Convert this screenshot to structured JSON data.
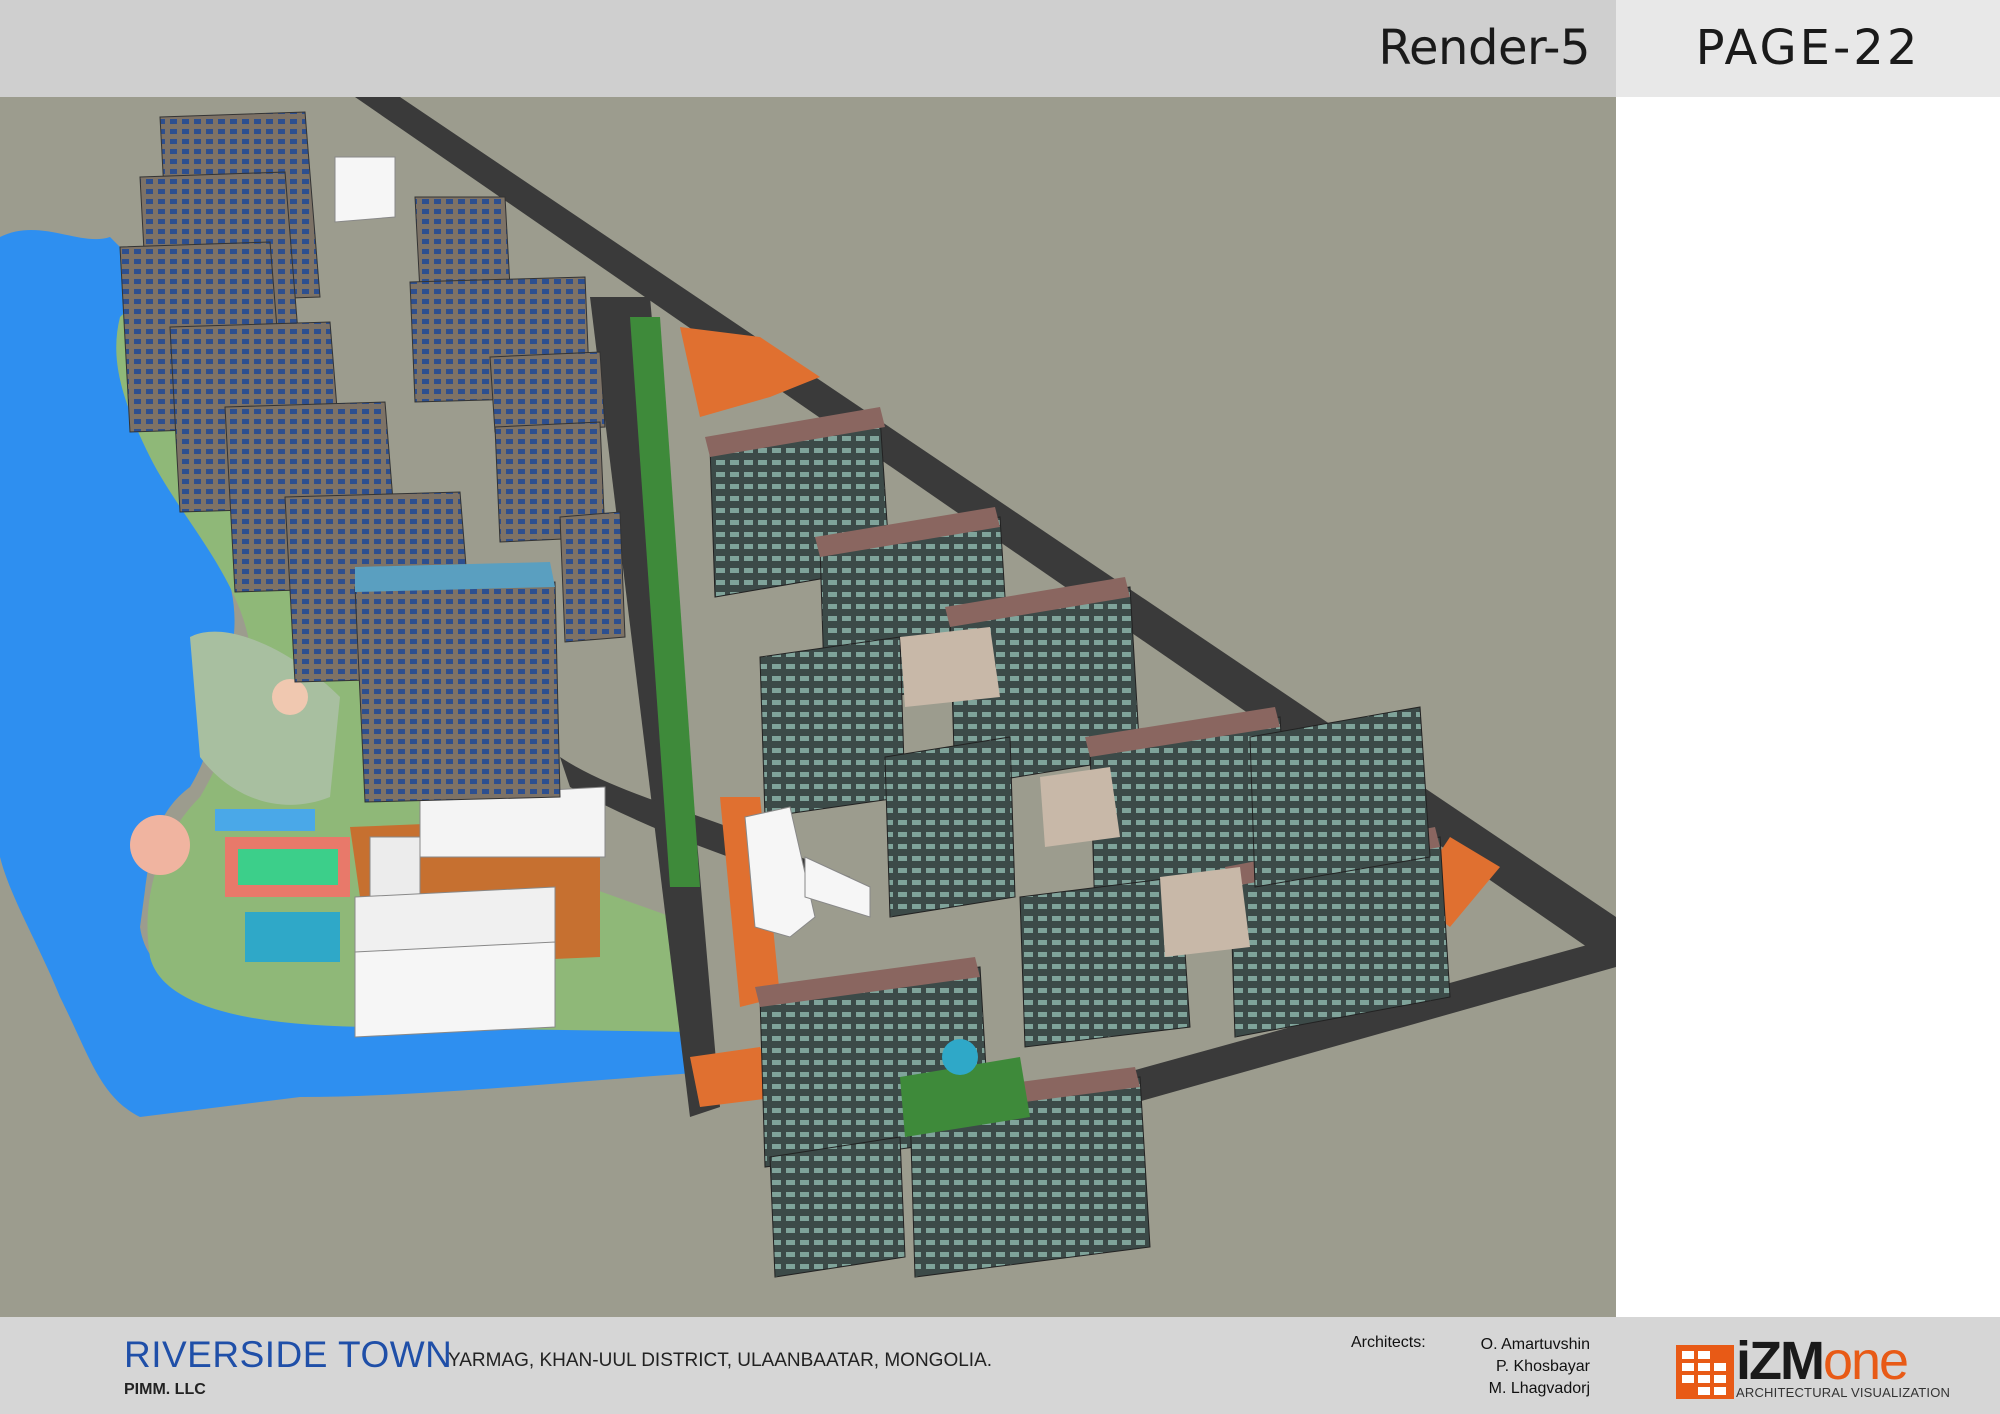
{
  "header": {
    "render_label": "Render-5",
    "page_label": "PAGE-22"
  },
  "image": {
    "icon": "aerial-site-render",
    "colors": {
      "ground": "#9c9c8e",
      "river": "#2e8ff0",
      "lawn": "#8fb878",
      "road": "#3a3a3a",
      "plaza": "#e07030",
      "roof": "#8a6660",
      "facade_dark": "#3c4a48",
      "facade_tower": "#7d7266"
    }
  },
  "footer": {
    "project_title": "RIVERSIDE TOWN",
    "location": "YARMAG, KHAN-UUL DISTRICT, ULAANBAATAR, MONGOLIA.",
    "company": "PIMM. LLC",
    "architects_label": "Architects:",
    "architects": [
      "O. Amartuvshin",
      "P. Khosbayar",
      "M. Lhagvadorj"
    ]
  },
  "logo": {
    "mark": "izmone-logo-mark",
    "prefix": "i",
    "middle": "ZM",
    "suffix": "one",
    "tagline": "ARCHITECTURAL VISUALIZATION",
    "accent": "#e85a16"
  }
}
